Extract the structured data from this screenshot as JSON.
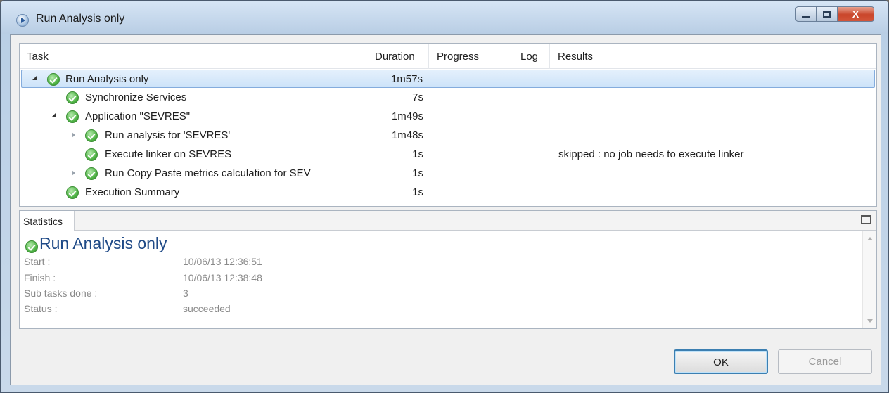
{
  "window": {
    "title": "Run Analysis only",
    "close_label": "X"
  },
  "tasks": {
    "columns": [
      "Task",
      "Duration",
      "Progress",
      "Log",
      "Results"
    ],
    "rows": [
      {
        "name": "Run Analysis only",
        "duration": "1m57s",
        "results": "",
        "expander": "open",
        "selected": true
      },
      {
        "name": "Synchronize Services",
        "duration": "7s",
        "results": "",
        "expander": "none"
      },
      {
        "name": "Application \"SEVRES\"",
        "duration": "1m49s",
        "results": "",
        "expander": "open"
      },
      {
        "name": "Run analysis for 'SEVRES'",
        "duration": "1m48s",
        "results": "",
        "expander": "closed"
      },
      {
        "name": "Execute linker on SEVRES",
        "duration": "1s",
        "results": "skipped : no job needs to execute linker",
        "expander": "none"
      },
      {
        "name": "Run Copy Paste metrics calculation for SEV",
        "duration": "1s",
        "results": "",
        "expander": "closed"
      },
      {
        "name": "Execution Summary",
        "duration": "1s",
        "results": "",
        "expander": "none"
      }
    ]
  },
  "statistics": {
    "tab_label": "Statistics",
    "heading": "Run Analysis only",
    "fields": [
      {
        "label": "Start :",
        "value": "10/06/13 12:36:51"
      },
      {
        "label": "Finish :",
        "value": "10/06/13 12:38:48"
      },
      {
        "label": "Sub tasks done :",
        "value": "3"
      },
      {
        "label": "Status :",
        "value": "succeeded"
      }
    ]
  },
  "buttons": {
    "ok": "OK",
    "cancel": "Cancel"
  }
}
